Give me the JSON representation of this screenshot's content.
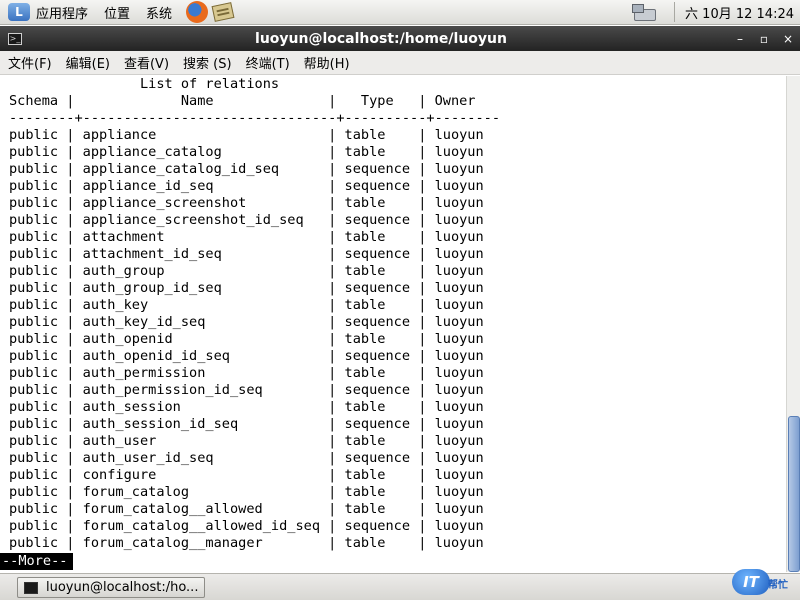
{
  "top_panel": {
    "menus": [
      "应用程序",
      "位置",
      "系统"
    ],
    "clock": "六 10月 12 14:24"
  },
  "window": {
    "title": "luoyun@localhost:/home/luoyun",
    "buttons": [
      "–",
      "▫",
      "×"
    ]
  },
  "menubar": [
    "文件(F)",
    "编辑(E)",
    "查看(V)",
    "搜索 (S)",
    "终端(T)",
    "帮助(H)"
  ],
  "terminal": {
    "lines": [
      "                List of relations",
      "Schema |             Name              |   Type   | Owner",
      "--------+-------------------------------+----------+--------",
      "public | appliance                     | table    | luoyun",
      "public | appliance_catalog             | table    | luoyun",
      "public | appliance_catalog_id_seq      | sequence | luoyun",
      "public | appliance_id_seq              | sequence | luoyun",
      "public | appliance_screenshot          | table    | luoyun",
      "public | appliance_screenshot_id_seq   | sequence | luoyun",
      "public | attachment                    | table    | luoyun",
      "public | attachment_id_seq             | sequence | luoyun",
      "public | auth_group                    | table    | luoyun",
      "public | auth_group_id_seq             | sequence | luoyun",
      "public | auth_key                      | table    | luoyun",
      "public | auth_key_id_seq               | sequence | luoyun",
      "public | auth_openid                   | table    | luoyun",
      "public | auth_openid_id_seq            | sequence | luoyun",
      "public | auth_permission               | table    | luoyun",
      "public | auth_permission_id_seq        | sequence | luoyun",
      "public | auth_session                  | table    | luoyun",
      "public | auth_session_id_seq           | sequence | luoyun",
      "public | auth_user                     | table    | luoyun",
      "public | auth_user_id_seq              | sequence | luoyun",
      "public | configure                     | table    | luoyun",
      "public | forum_catalog                 | table    | luoyun",
      "public | forum_catalog__allowed        | table    | luoyun",
      "public | forum_catalog__allowed_id_seq | sequence | luoyun",
      "public | forum_catalog__manager        | table    | luoyun"
    ],
    "pager_prompt": "--More--"
  },
  "taskbar": {
    "task_label": "luoyun@localhost:/ho..."
  },
  "watermark": {
    "badge": "IT",
    "text": "帮忙"
  }
}
